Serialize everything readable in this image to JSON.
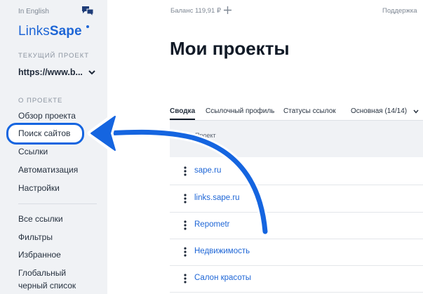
{
  "sidebar": {
    "language_link": "In English",
    "logo": {
      "part1": "Links",
      "part2": "Sape"
    },
    "current_project_label": "ТЕКУЩИЙ ПРОЕКТ",
    "current_project_value": "https://www.b...",
    "about_section_label": "О ПРОЕКТЕ",
    "nav_items": [
      {
        "label": "Обзор проекта"
      },
      {
        "label": "Поиск сайтов"
      },
      {
        "label": "Ссылки"
      },
      {
        "label": "Автоматизация"
      },
      {
        "label": "Настройки"
      }
    ],
    "nav_items_2": [
      {
        "label": "Все ссылки"
      },
      {
        "label": "Фильтры"
      },
      {
        "label": "Избранное"
      },
      {
        "label": "Глобальный"
      },
      {
        "label": "черный список"
      }
    ]
  },
  "header": {
    "balance": "Баланс 119,91 ₽",
    "support": "Поддержка"
  },
  "main": {
    "title": "Мои проекты",
    "tabs": [
      {
        "label": "Сводка"
      },
      {
        "label": "Ссылочный профиль"
      },
      {
        "label": "Статусы ссылок"
      }
    ],
    "view_select": "Основная (14/14)",
    "table": {
      "column_header": "Проект",
      "rows": [
        {
          "name": "sape.ru"
        },
        {
          "name": "links.sape.ru"
        },
        {
          "name": "Repometr"
        },
        {
          "name": "Недвижимость"
        },
        {
          "name": "Салон красоты"
        }
      ]
    }
  },
  "colors": {
    "accent": "#1e66d6",
    "highlight": "#1565e0",
    "sidebar_bg": "#f0f2f5"
  }
}
